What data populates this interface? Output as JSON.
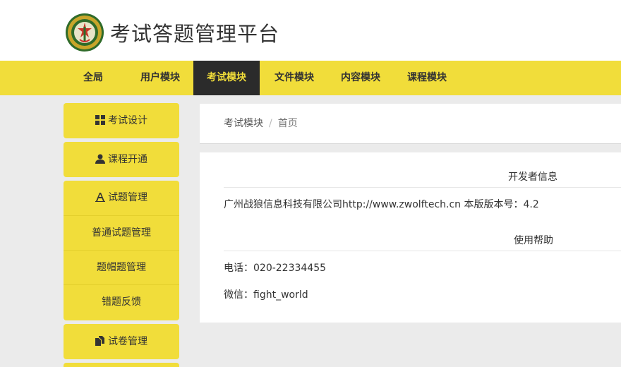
{
  "header": {
    "title": "考试答题管理平台"
  },
  "nav": {
    "items": [
      {
        "label": "全局"
      },
      {
        "label": "用户模块"
      },
      {
        "label": "考试模块"
      },
      {
        "label": "文件模块"
      },
      {
        "label": "内容模块"
      },
      {
        "label": "课程模块"
      }
    ],
    "active_index": 2
  },
  "sidebar": {
    "exam_design": "考试设计",
    "course_open": "课程开通",
    "question_mgmt": "试题管理",
    "question_sub": [
      "普通试题管理",
      "题帽题管理",
      "错题反馈"
    ],
    "paper_mgmt": "试卷管理"
  },
  "breadcrumb": {
    "module": "考试模块",
    "separator": "/",
    "current": "首页"
  },
  "info": {
    "developer_heading": "开发者信息",
    "developer_text": "广州战狼信息科技有限公司http://www.zwolftech.cn 本版版本号：4.2",
    "help_heading": "使用帮助",
    "phone": "电话：020-22334455",
    "wechat": "微信：fight_world"
  },
  "colors": {
    "accent": "#f1dd3a",
    "nav_active_bg": "#2b2b2b",
    "background": "#ebebeb"
  }
}
